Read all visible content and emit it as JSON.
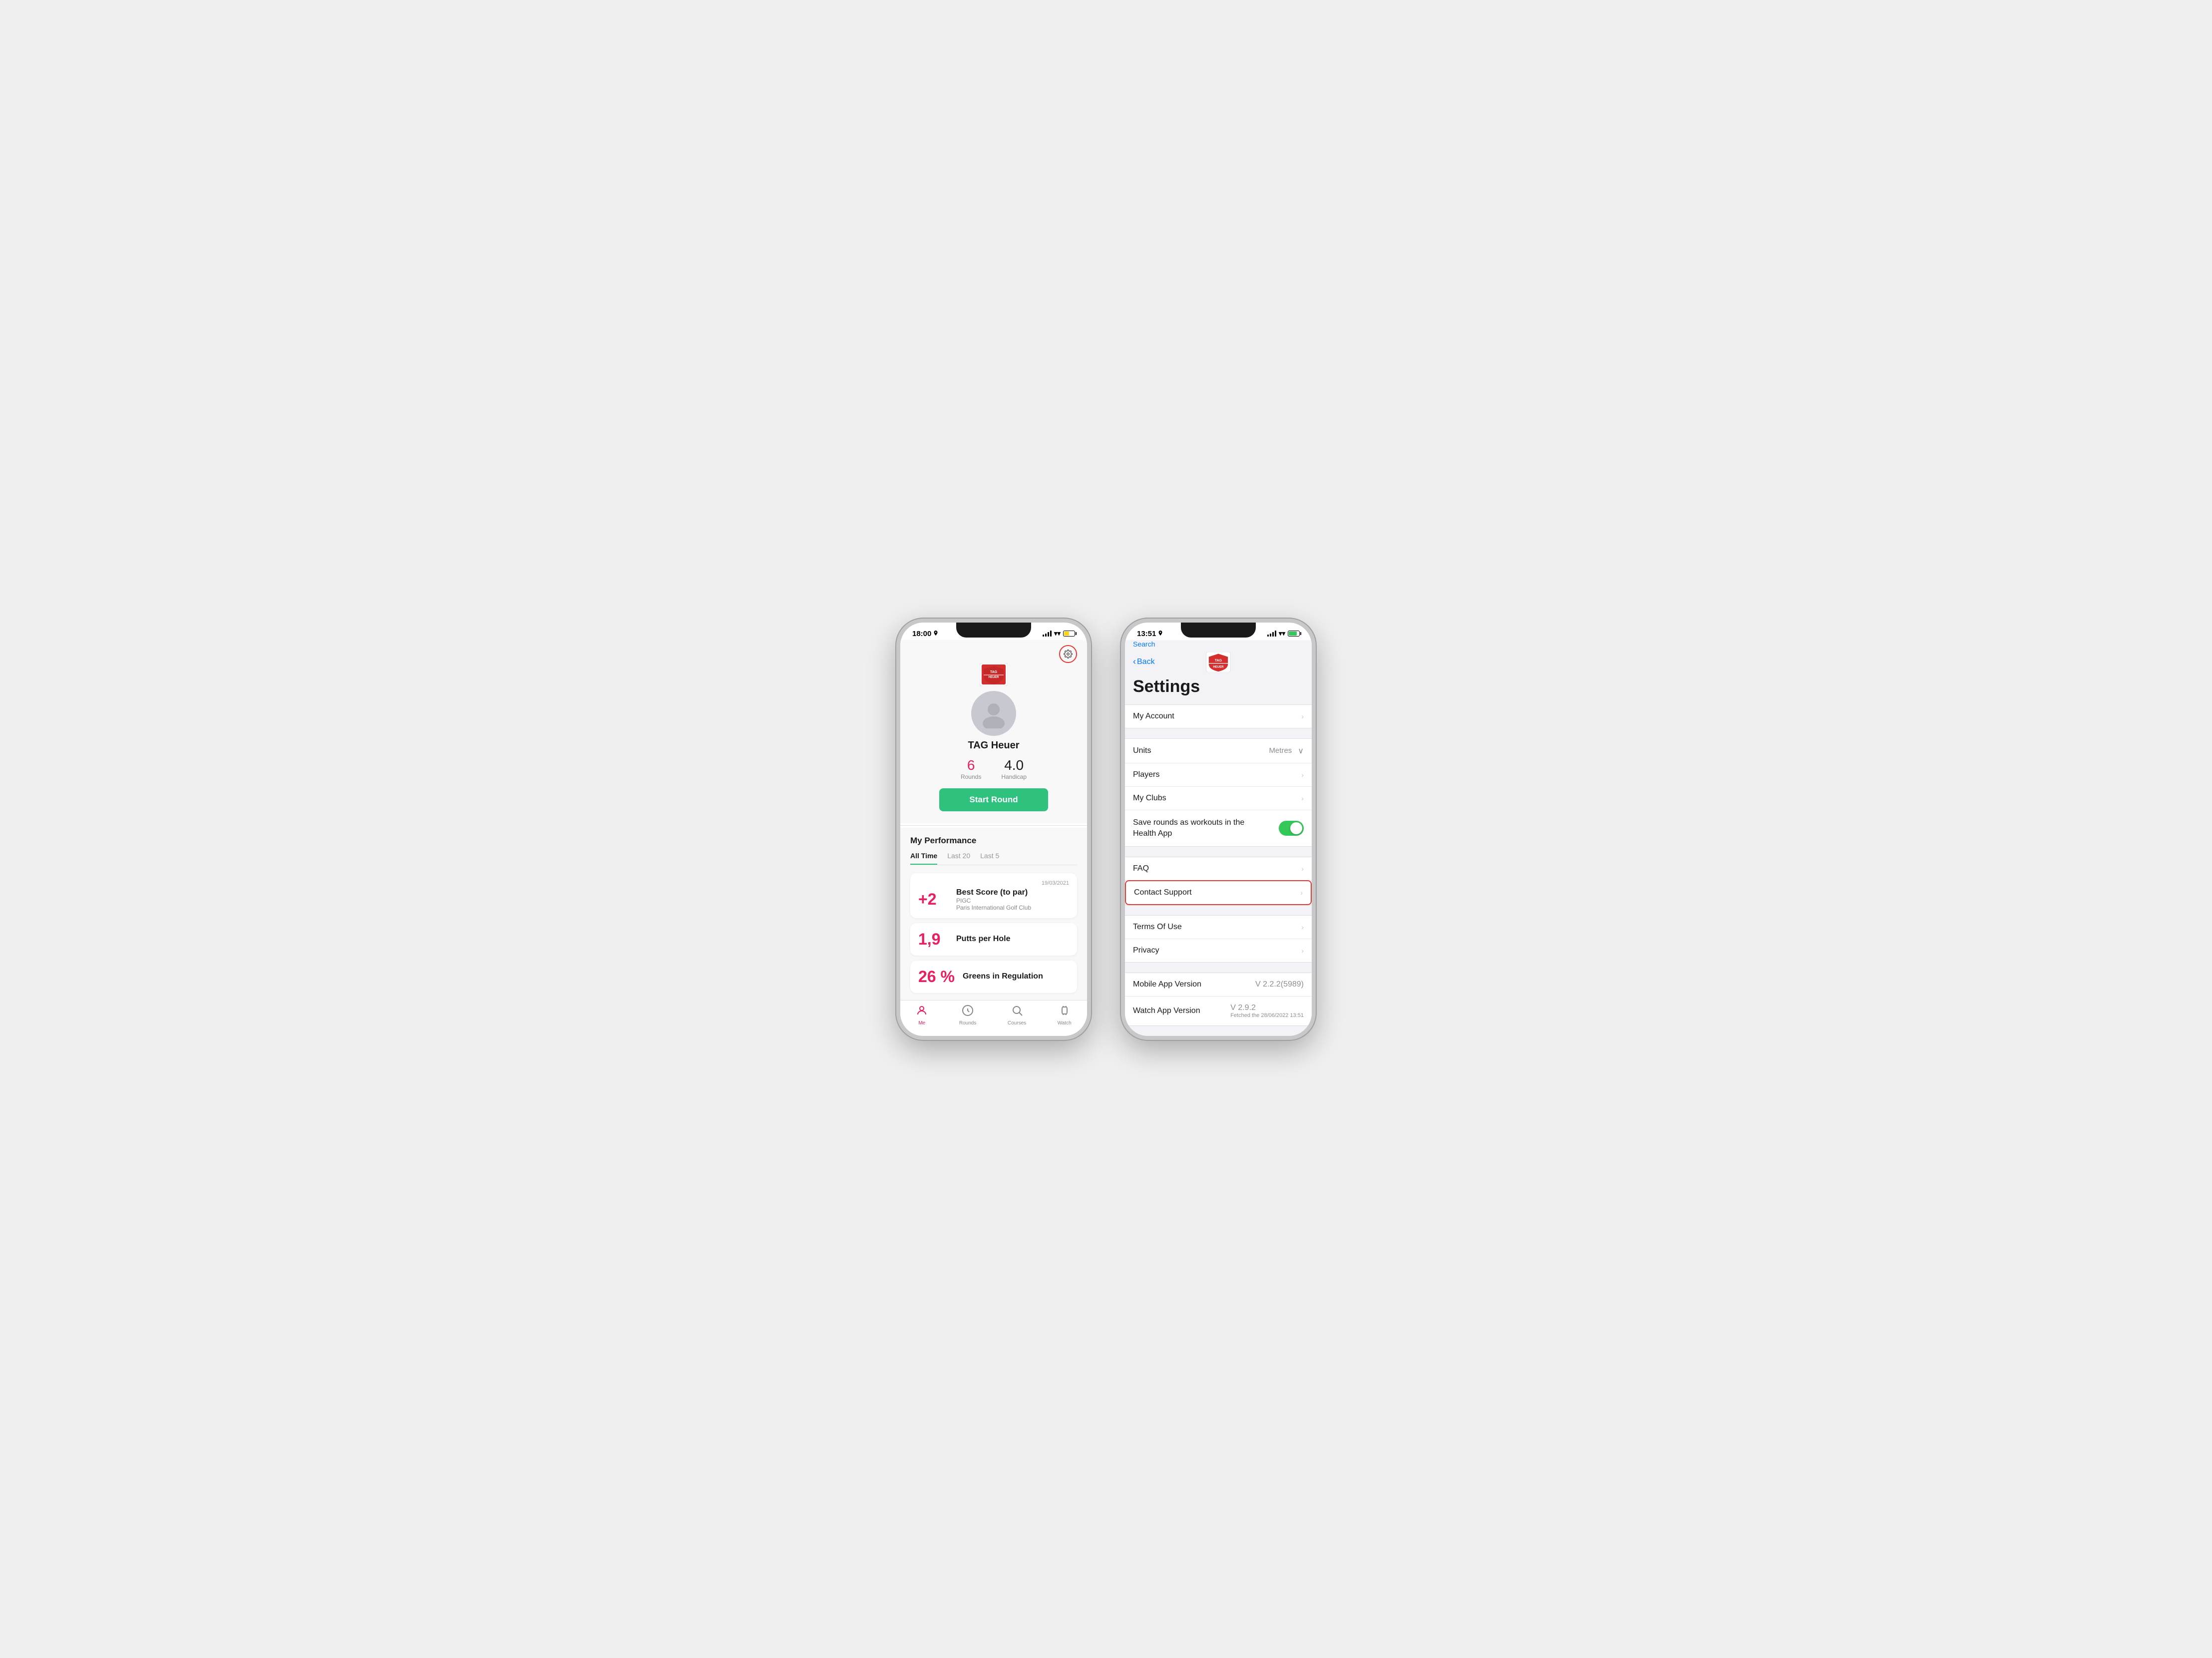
{
  "phone1": {
    "status": {
      "time": "18:00",
      "location": true
    },
    "header": {
      "user_name": "TAG Heuer",
      "rounds_label": "Rounds",
      "rounds_value": "6",
      "handicap_label": "Handicap",
      "handicap_value": "4.0"
    },
    "start_round_label": "Start Round",
    "performance": {
      "title": "My Performance",
      "tabs": [
        "All Time",
        "Last 20",
        "Last 5"
      ],
      "active_tab": 0,
      "stats": [
        {
          "value": "+2",
          "title": "Best Score (to par)",
          "subtitle1": "PIGC",
          "subtitle2": "Paris International Golf Club",
          "date": "19/03/2021"
        },
        {
          "value": "1,9",
          "title": "Putts per Hole",
          "subtitle1": "",
          "subtitle2": "",
          "date": ""
        },
        {
          "value": "26 %",
          "title": "Greens in Regulation",
          "subtitle1": "",
          "subtitle2": "",
          "date": ""
        }
      ]
    },
    "bottom_nav": [
      {
        "label": "Me",
        "icon": "person",
        "active": true
      },
      {
        "label": "Rounds",
        "icon": "rounds",
        "active": false
      },
      {
        "label": "Courses",
        "icon": "courses",
        "active": false
      },
      {
        "label": "Watch",
        "icon": "watch",
        "active": false
      }
    ]
  },
  "phone2": {
    "status": {
      "time": "13:51",
      "location": true
    },
    "nav": {
      "search_label": "Search",
      "back_label": "Back"
    },
    "title": "Settings",
    "rows": [
      {
        "id": "my-account",
        "label": "My Account",
        "right_type": "chevron",
        "right_value": ""
      },
      {
        "id": "units",
        "label": "Units",
        "right_type": "dropdown",
        "right_value": "Metres"
      },
      {
        "id": "players",
        "label": "Players",
        "right_type": "chevron",
        "right_value": ""
      },
      {
        "id": "my-clubs",
        "label": "My Clubs",
        "right_type": "chevron",
        "right_value": ""
      },
      {
        "id": "save-rounds",
        "label": "Save rounds as workouts in the Health App",
        "right_type": "toggle",
        "right_value": "on"
      },
      {
        "id": "faq",
        "label": "FAQ",
        "right_type": "chevron",
        "right_value": ""
      },
      {
        "id": "contact-support",
        "label": "Contact Support",
        "right_type": "chevron",
        "right_value": "",
        "highlighted": true
      },
      {
        "id": "terms-of-use",
        "label": "Terms Of Use",
        "right_type": "chevron",
        "right_value": ""
      },
      {
        "id": "privacy",
        "label": "Privacy",
        "right_type": "chevron",
        "right_value": ""
      },
      {
        "id": "mobile-app-version",
        "label": "Mobile App Version",
        "right_type": "version",
        "right_value": "V 2.2.2(5989)"
      },
      {
        "id": "watch-app-version",
        "label": "Watch App Version",
        "right_type": "version_sub",
        "right_value": "V 2.9.2",
        "sub_value": "Fetched the 28/06/2022 13:51"
      }
    ]
  }
}
